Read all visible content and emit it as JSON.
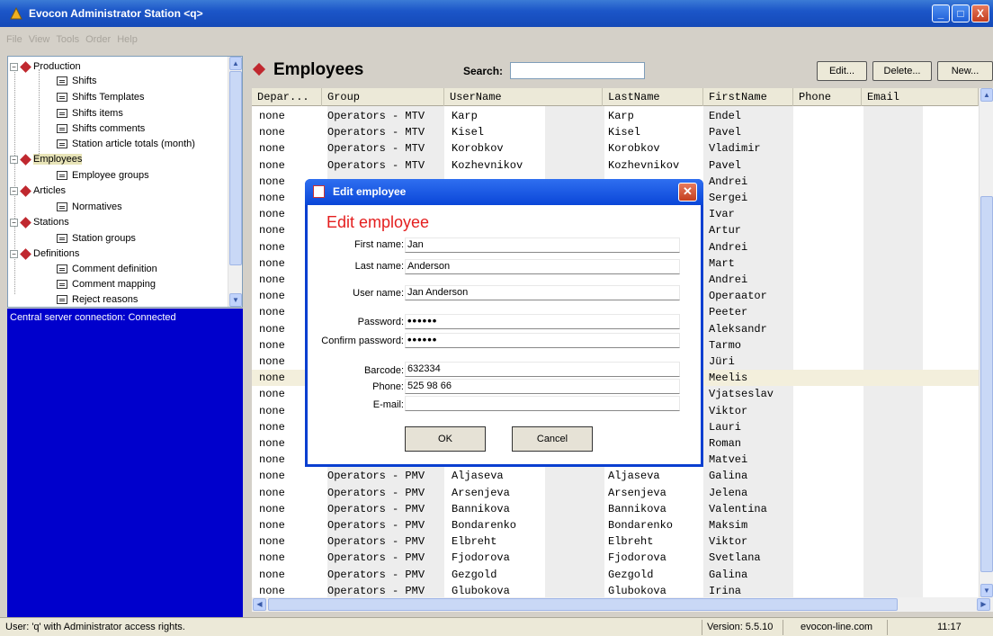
{
  "window": {
    "title": "Evocon Administrator Station  <q>",
    "minimize": "_",
    "maximize": "□",
    "close": "X"
  },
  "menu": [
    "File",
    "View",
    "Tools",
    "Order",
    "Help"
  ],
  "tree": [
    {
      "label": "Production",
      "type": "root"
    },
    {
      "label": "Shifts",
      "type": "child"
    },
    {
      "label": "Shifts Templates",
      "type": "child"
    },
    {
      "label": "Shifts items",
      "type": "child"
    },
    {
      "label": "Shifts comments",
      "type": "child"
    },
    {
      "label": "Station article totals (month)",
      "type": "child"
    },
    {
      "label": "Employees",
      "type": "root",
      "selected": true
    },
    {
      "label": "Employee groups",
      "type": "child"
    },
    {
      "label": "Articles",
      "type": "root"
    },
    {
      "label": "Normatives",
      "type": "child"
    },
    {
      "label": "Stations",
      "type": "root"
    },
    {
      "label": "Station groups",
      "type": "child"
    },
    {
      "label": "Definitions",
      "type": "root"
    },
    {
      "label": "Comment definition",
      "type": "child"
    },
    {
      "label": "Comment mapping",
      "type": "child"
    },
    {
      "label": "Reject reasons",
      "type": "child"
    }
  ],
  "connection_status": "Central server connection:  Connected",
  "header": {
    "title": "Employees",
    "search_label": "Search:",
    "search_value": "",
    "edit_btn": "Edit...",
    "delete_btn": "Delete...",
    "new_btn": "New..."
  },
  "columns": [
    "Depar...",
    "Group",
    "UserName",
    "LastName",
    "FirstName",
    "Phone",
    "Email"
  ],
  "rows": [
    [
      "none",
      "Operators - MTV",
      "Karp",
      "Karp",
      "Endel"
    ],
    [
      "none",
      "Operators - MTV",
      "Kisel",
      "Kisel",
      "Pavel"
    ],
    [
      "none",
      "Operators - MTV",
      "Korobkov",
      "Korobkov",
      "Vladimir"
    ],
    [
      "none",
      "Operators - MTV",
      "Kozhevnikov",
      "Kozhevnikov",
      "Pavel"
    ],
    [
      "none",
      "",
      "",
      "",
      "Andrei"
    ],
    [
      "none",
      "",
      "",
      "",
      "Sergei"
    ],
    [
      "none",
      "",
      "",
      "",
      "Ivar"
    ],
    [
      "none",
      "",
      "",
      "",
      "Artur"
    ],
    [
      "none",
      "",
      "",
      "",
      "Andrei"
    ],
    [
      "none",
      "",
      "",
      "",
      "Mart"
    ],
    [
      "none",
      "",
      "",
      "",
      "Andrei"
    ],
    [
      "none",
      "",
      "",
      "",
      "Operaator"
    ],
    [
      "none",
      "",
      "",
      "",
      "Peeter"
    ],
    [
      "none",
      "",
      "",
      "",
      "Aleksandr"
    ],
    [
      "none",
      "",
      "",
      "",
      "Tarmo"
    ],
    [
      "none",
      "",
      "",
      "",
      "Jüri"
    ],
    [
      "none",
      "",
      "",
      "",
      "Meelis"
    ],
    [
      "none",
      "",
      "",
      "",
      "Vjatseslav"
    ],
    [
      "none",
      "",
      "",
      "",
      "Viktor"
    ],
    [
      "none",
      "",
      "",
      "",
      "Lauri"
    ],
    [
      "none",
      "",
      "",
      "",
      "Roman"
    ],
    [
      "none",
      "",
      "",
      "",
      "Matvei"
    ],
    [
      "none",
      "Operators - PMV",
      "Aljaseva",
      "Aljaseva",
      "Galina"
    ],
    [
      "none",
      "Operators - PMV",
      "Arsenjeva",
      "Arsenjeva",
      "Jelena"
    ],
    [
      "none",
      "Operators - PMV",
      "Bannikova",
      "Bannikova",
      "Valentina"
    ],
    [
      "none",
      "Operators - PMV",
      "Bondarenko",
      "Bondarenko",
      "Maksim"
    ],
    [
      "none",
      "Operators - PMV",
      "Elbreht",
      "Elbreht",
      "Viktor"
    ],
    [
      "none",
      "Operators - PMV",
      "Fjodorova",
      "Fjodorova",
      "Svetlana"
    ],
    [
      "none",
      "Operators - PMV",
      "Gezgold",
      "Gezgold",
      "Galina"
    ],
    [
      "none",
      "Operators - PMV",
      "Glubokova",
      "Glubokova",
      "Irina"
    ]
  ],
  "highlighted_row": 16,
  "dialog": {
    "title": "Edit employee",
    "heading": "Edit employee",
    "fields": [
      {
        "label": "First name:",
        "value": "Jan"
      },
      {
        "label": "Last name:",
        "value": "Anderson"
      },
      {
        "label": "User name:",
        "value": "Jan Anderson"
      },
      {
        "label": "Password:",
        "value": "••••••"
      },
      {
        "label": "Confirm password:",
        "value": "••••••"
      },
      {
        "label": "Barcode:",
        "value": "632334"
      },
      {
        "label": "Phone:",
        "value": "525 98 66"
      },
      {
        "label": "E-mail:",
        "value": ""
      }
    ],
    "ok": "OK",
    "cancel": "Cancel"
  },
  "statusbar": {
    "user": "User: 'q' with Administrator access rights.",
    "version": "Version: 5.5.10",
    "site": "evocon-line.com",
    "time": "11:17"
  },
  "colors": {
    "title_blue": "#1c56c8",
    "panel_blue": "#0000cc",
    "accent_red": "#e41e1e",
    "tree_icon": "#c0282f"
  }
}
